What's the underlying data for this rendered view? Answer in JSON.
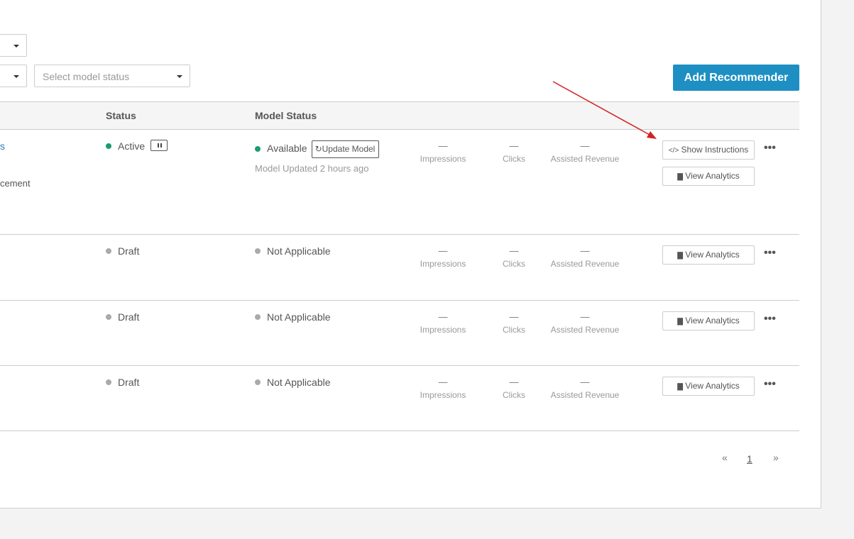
{
  "filters": {
    "top_select": {
      "placeholder": ""
    },
    "left_select": {
      "placeholder": ""
    },
    "model_status_select": {
      "placeholder": "Select model status"
    }
  },
  "add_button_label": "Add Recommender",
  "columns": {
    "status": "Status",
    "model_status": "Model Status"
  },
  "rows": [
    {
      "name_partial": "s",
      "subtitle_partial": "cement",
      "status": "Active",
      "status_color": "#1a9e6b",
      "model_status": "Available",
      "model_status_color": "#1a9e6b",
      "update_model_label": "Update Model",
      "model_updated": "Model Updated 2 hours ago",
      "impressions": "—",
      "clicks": "—",
      "revenue": "—",
      "show_instructions_label": "Show Instructions",
      "view_analytics_label": "View Analytics"
    },
    {
      "status": "Draft",
      "status_color": "#aaaaaa",
      "model_status": "Not Applicable",
      "model_status_color": "#aaaaaa",
      "impressions": "—",
      "clicks": "—",
      "revenue": "—",
      "view_analytics_label": "View Analytics"
    },
    {
      "status": "Draft",
      "status_color": "#aaaaaa",
      "model_status": "Not Applicable",
      "model_status_color": "#aaaaaa",
      "impressions": "—",
      "clicks": "—",
      "revenue": "—",
      "view_analytics_label": "View Analytics"
    },
    {
      "status": "Draft",
      "status_color": "#aaaaaa",
      "model_status": "Not Applicable",
      "model_status_color": "#aaaaaa",
      "impressions": "—",
      "clicks": "—",
      "revenue": "—",
      "view_analytics_label": "View Analytics"
    }
  ],
  "metric_labels": {
    "impressions": "Impressions",
    "clicks": "Clicks",
    "revenue": "Assisted Revenue"
  },
  "more_icon": "•••",
  "pagination": {
    "prev": "«",
    "current": "1",
    "next": "»"
  },
  "annotation": {
    "type": "arrow",
    "color": "#d42020",
    "target": "show-instructions-button"
  }
}
